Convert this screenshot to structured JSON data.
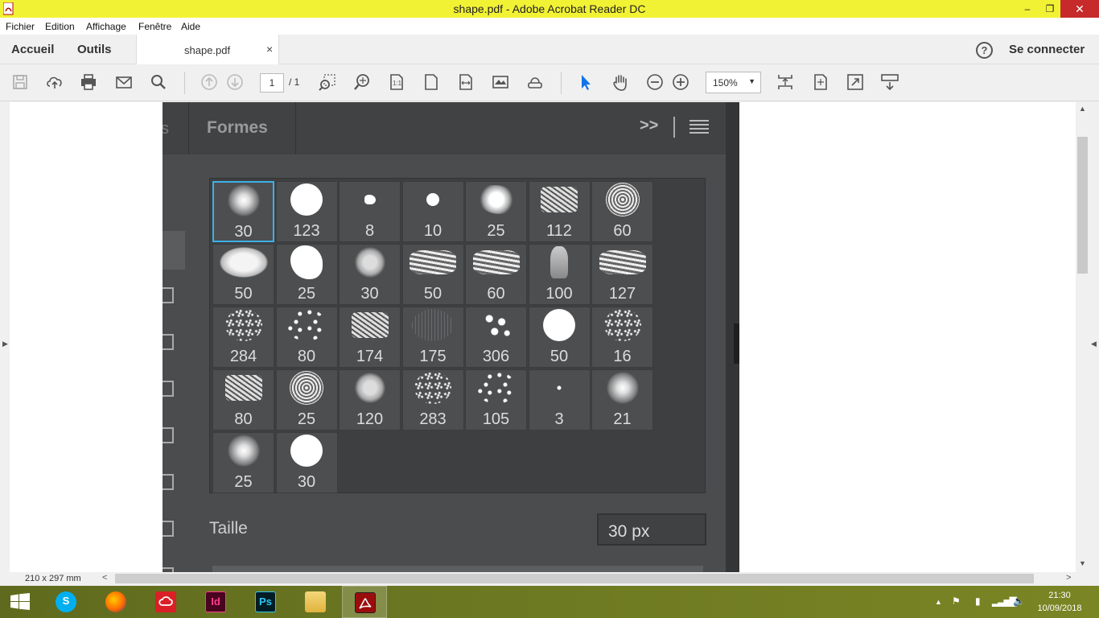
{
  "window": {
    "title": "shape.pdf - Adobe Acrobat Reader DC",
    "min": "–",
    "max": "❐",
    "close": "✕"
  },
  "menu": [
    "Fichier",
    "Edition",
    "Affichage",
    "Fenêtre",
    "Aide"
  ],
  "tabs": {
    "home": "Accueil",
    "tools": "Outils",
    "document": "shape.pdf",
    "close": "×"
  },
  "account": {
    "help": "?",
    "signin": "Se connecter"
  },
  "toolbar": {
    "page_current": "1",
    "page_total": "/ 1",
    "zoom": "150%",
    "zoom_arrow": "▼"
  },
  "panel": {
    "partial_tab": "s",
    "tab": "Formes",
    "expand": ">>",
    "size_label": "Taille",
    "size_value": "30 px",
    "brushes": [
      {
        "size": "30",
        "style": "soft",
        "selected": true
      },
      {
        "size": "123",
        "style": "hard"
      },
      {
        "size": "8",
        "style": "splat-small"
      },
      {
        "size": "10",
        "style": "dot-rough"
      },
      {
        "size": "25",
        "style": "splat"
      },
      {
        "size": "112",
        "style": "texture"
      },
      {
        "size": "60",
        "style": "speckle"
      },
      {
        "size": "50",
        "style": "oval-texture"
      },
      {
        "size": "25",
        "style": "blob"
      },
      {
        "size": "30",
        "style": "fuzzy"
      },
      {
        "size": "50",
        "style": "streak"
      },
      {
        "size": "60",
        "style": "streak"
      },
      {
        "size": "100",
        "style": "chalk"
      },
      {
        "size": "127",
        "style": "streak"
      },
      {
        "size": "284",
        "style": "scatter"
      },
      {
        "size": "80",
        "style": "scatter-sparse"
      },
      {
        "size": "174",
        "style": "texture"
      },
      {
        "size": "175",
        "style": "faint"
      },
      {
        "size": "306",
        "style": "leaves"
      },
      {
        "size": "50",
        "style": "hard"
      },
      {
        "size": "16",
        "style": "scatter"
      },
      {
        "size": "80",
        "style": "texture"
      },
      {
        "size": "25",
        "style": "speckle"
      },
      {
        "size": "120",
        "style": "fuzzy"
      },
      {
        "size": "283",
        "style": "scatter"
      },
      {
        "size": "105",
        "style": "scatter-sparse"
      },
      {
        "size": "3",
        "style": "tiny"
      },
      {
        "size": "21",
        "style": "soft"
      },
      {
        "size": "25",
        "style": "soft"
      },
      {
        "size": "30",
        "style": "hard"
      }
    ]
  },
  "status": {
    "dimensions": "210 x 297 mm"
  },
  "taskbar": {
    "apps": [
      {
        "name": "windows-start",
        "label": ""
      },
      {
        "name": "skype",
        "label": "S"
      },
      {
        "name": "firefox",
        "label": ""
      },
      {
        "name": "creative-cloud",
        "label": ""
      },
      {
        "name": "indesign",
        "label": "Id"
      },
      {
        "name": "photoshop",
        "label": "Ps"
      },
      {
        "name": "file-explorer",
        "label": ""
      },
      {
        "name": "acrobat",
        "label": ""
      }
    ],
    "time": "21:30",
    "date": "10/09/2018"
  },
  "colors": {
    "titlebar": "#f2f235",
    "selected_border": "#3db0e8",
    "panel_bg": "#4a4c4e"
  }
}
